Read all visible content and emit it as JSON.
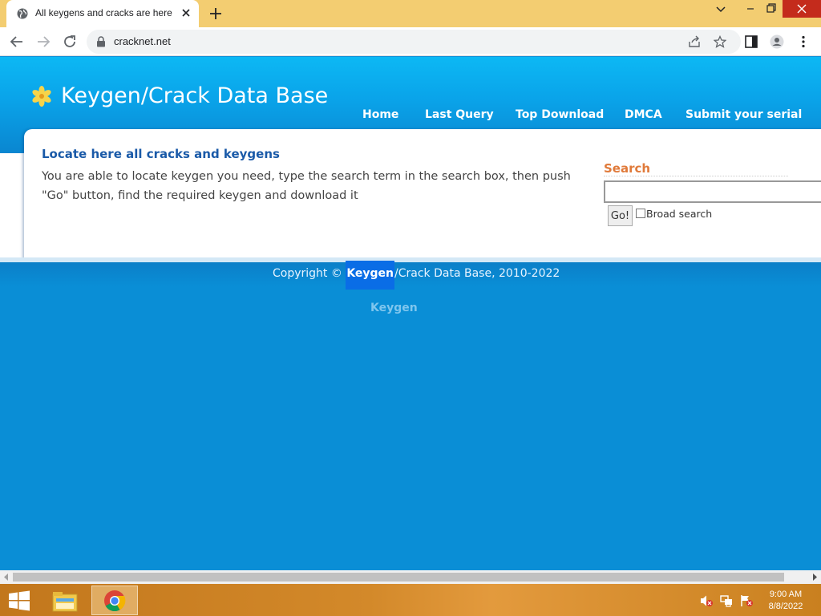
{
  "browser": {
    "tab_title": "All keygens and cracks are here",
    "url": "cracknet.net"
  },
  "site": {
    "title": "Keygen/Crack Data Base",
    "nav": [
      "Home",
      "Last Query",
      "Top Download",
      "DMCA",
      "Submit your serial"
    ]
  },
  "main": {
    "heading": "Locate here all cracks and keygens",
    "body": "You are able to locate keygen you need, type the search term in the search box, then push \"Go\" button, find the required keygen and download it"
  },
  "search": {
    "label": "Search",
    "input_value": "",
    "go_label": "Go!",
    "broad_label": "Broad search",
    "broad_checked": false
  },
  "footer": {
    "copyright_prefix": "Copyright © ",
    "copyright_highlight": "Keygen",
    "copyright_suffix": "/Crack Data Base, 2010-2022",
    "link": "Keygen"
  },
  "taskbar": {
    "time": "9:00 AM",
    "date": "8/8/2022"
  },
  "colors": {
    "header_blue": "#0aa3e9",
    "page_blue": "#0a8ed6",
    "heading_blue": "#1a5aa8",
    "search_orange": "#e07a3a",
    "tabstrip": "#f3cd71"
  }
}
